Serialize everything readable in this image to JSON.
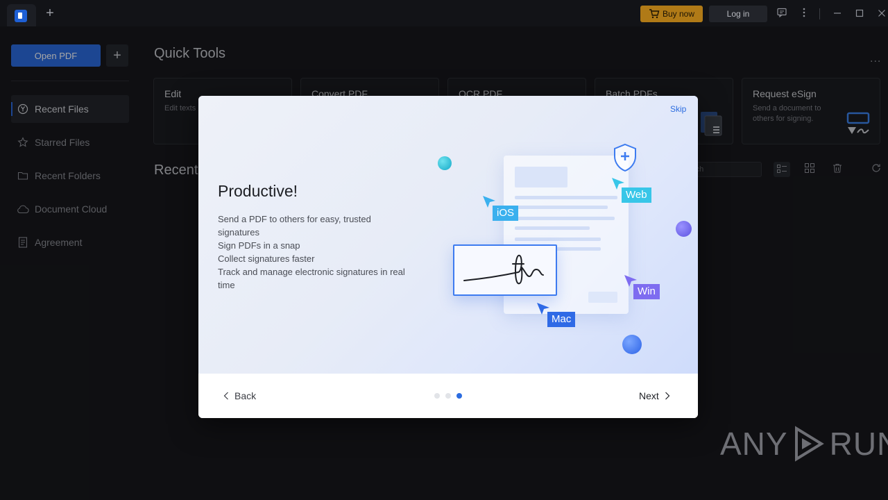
{
  "titlebar": {
    "buy_now_label": "Buy now",
    "login_label": "Log in",
    "new_tab_symbol": "+"
  },
  "sidebar": {
    "open_pdf_label": "Open PDF",
    "add_symbol": "+",
    "items": [
      {
        "label": "Recent Files",
        "icon": "clock-icon",
        "active": true
      },
      {
        "label": "Starred Files",
        "icon": "star-icon"
      },
      {
        "label": "Recent Folders",
        "icon": "folder-icon"
      },
      {
        "label": "Document Cloud",
        "icon": "cloud-icon"
      },
      {
        "label": "Agreement",
        "icon": "document-icon"
      }
    ]
  },
  "main": {
    "quick_tools_title": "Quick Tools",
    "more_symbol": "...",
    "tools": [
      {
        "title": "Edit",
        "desc": "Edit texts in a file."
      },
      {
        "title": "Convert PDF",
        "desc": ""
      },
      {
        "title": "OCR PDF",
        "desc": ""
      },
      {
        "title": "Batch PDFs",
        "desc": ""
      },
      {
        "title": "Request eSign",
        "desc": "Send a document to others for signing."
      }
    ],
    "recent_title": "Recent",
    "search_placeholder": "rch"
  },
  "dialog": {
    "skip_label": "Skip",
    "title": "Productive!",
    "features": [
      "Send a PDF to others for easy, trusted signatures",
      "Sign PDFs in a snap",
      "Collect signatures faster",
      "Track and manage electronic signatures in real time"
    ],
    "platforms": {
      "ios": "iOS",
      "web": "Web",
      "win": "Win",
      "mac": "Mac"
    },
    "back_label": "Back",
    "next_label": "Next",
    "pagination": {
      "total": 3,
      "current": 3
    }
  },
  "colors": {
    "accent": "#2c6ce0",
    "buy_now": "#b07a17",
    "ios_badge": "#3ab0ee",
    "web_badge": "#38c6e8",
    "win_badge": "#7e6cf0",
    "mac_badge": "#2f6ae6"
  },
  "watermark": {
    "text_left": "ANY",
    "text_right": "RUN"
  }
}
